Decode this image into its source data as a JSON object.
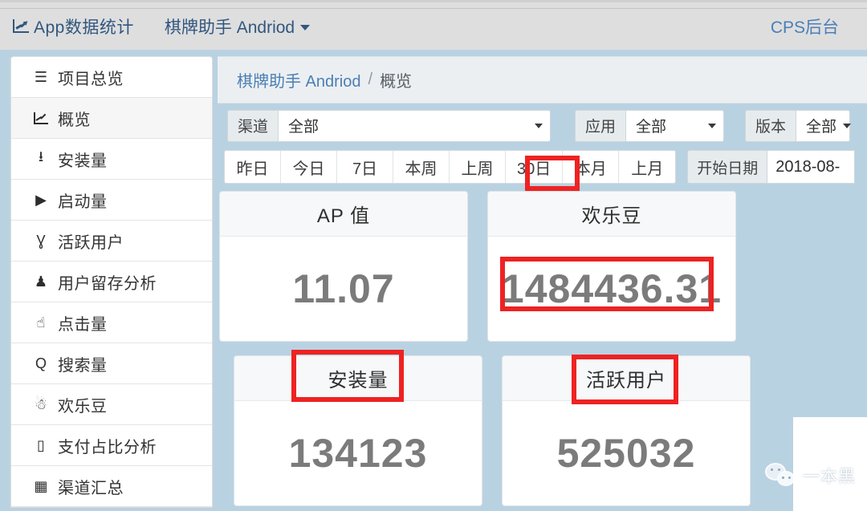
{
  "topbar": {
    "brand_label": "App数据统计",
    "brand_icon": "line-chart-icon",
    "app_switcher_label": "棋牌助手 Andriod",
    "app_switcher_caret": "chevron-down-icon",
    "right_link_label": "CPS后台"
  },
  "sidebar": {
    "items": [
      {
        "icon": "hamburger-menu-icon",
        "glyph": "☰",
        "label": "项目总览",
        "active": false
      },
      {
        "icon": "line-chart-icon",
        "glyph": "",
        "label": "概览",
        "active": true
      },
      {
        "icon": "download-icon",
        "glyph": "⭳",
        "label": "安装量",
        "active": false
      },
      {
        "icon": "play-triangle-icon",
        "glyph": "▶",
        "label": "启动量",
        "active": false
      },
      {
        "icon": "person-icon",
        "glyph": "Ɣ",
        "label": "活跃用户",
        "active": false
      },
      {
        "icon": "retention-lock-icon",
        "glyph": "♟",
        "label": "用户留存分析",
        "active": false
      },
      {
        "icon": "hand-click-icon",
        "glyph": "☝",
        "label": "点击量",
        "active": false
      },
      {
        "icon": "search-icon",
        "glyph": "Q",
        "label": "搜索量",
        "active": false
      },
      {
        "icon": "gift-icon",
        "glyph": "☃",
        "label": "欢乐豆",
        "active": false
      },
      {
        "icon": "mobile-phone-icon",
        "glyph": "▯",
        "label": "支付占比分析",
        "active": false
      },
      {
        "icon": "table-grid-icon",
        "glyph": "▦",
        "label": "渠道汇总",
        "active": false
      }
    ]
  },
  "breadcrumb": {
    "app_label": "棋牌助手 Andriod",
    "separator": "/",
    "current_label": "概览"
  },
  "filters": [
    {
      "name": "channel",
      "addon_label": "渠道",
      "value": "全部"
    },
    {
      "name": "app",
      "addon_label": "应用",
      "value": "全部"
    },
    {
      "name": "version",
      "addon_label": "版本",
      "value": "全部"
    }
  ],
  "date_tabs": {
    "items": [
      {
        "label": "昨日",
        "selected": false
      },
      {
        "label": "今日",
        "selected": false
      },
      {
        "label": "7日",
        "selected": false
      },
      {
        "label": "本周",
        "selected": false
      },
      {
        "label": "上周",
        "selected": false
      },
      {
        "label": "30日",
        "selected": true
      },
      {
        "label": "本月",
        "selected": false
      },
      {
        "label": "上月",
        "selected": false
      }
    ],
    "start_date_addon": "开始日期",
    "start_date_value": "2018-08-"
  },
  "cards": [
    {
      "name": "ap-value",
      "title": "AP 值",
      "value": "11.07",
      "highlight_title": false,
      "highlight_value": false
    },
    {
      "name": "happy-beans",
      "title": "欢乐豆",
      "value": "1484436.31",
      "highlight_title": false,
      "highlight_value": true
    },
    {
      "name": "installs",
      "title": "安装量",
      "value": "134123",
      "highlight_title": true,
      "highlight_value": false
    },
    {
      "name": "active-users",
      "title": "活跃用户",
      "value": "525032",
      "highlight_title": true,
      "highlight_value": false
    }
  ],
  "annotations": {
    "color": "#ee2222",
    "boxes": [
      "30日",
      "1484436.31",
      "安装量",
      "活跃用户"
    ]
  },
  "watermark": {
    "logo": "wechat-logo-icon",
    "text": "一本黑"
  },
  "colors": {
    "page_background": "#b9d2e2",
    "topbar_background": "#dededf",
    "brand_blue": "#31577d",
    "link_blue": "#4a7fb5",
    "card_value_gray": "#7b7b7b",
    "annotation_red": "#ee2222"
  }
}
